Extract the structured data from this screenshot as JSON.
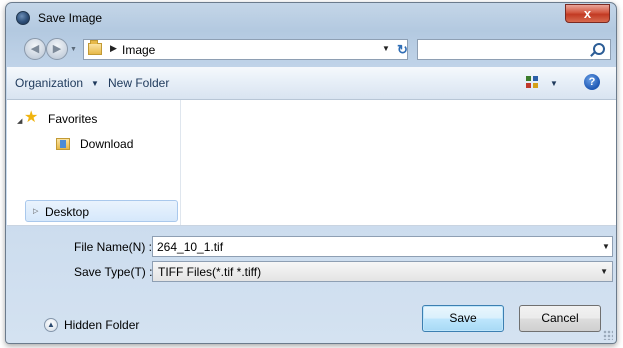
{
  "window": {
    "title": "Save Image",
    "close_label": "x"
  },
  "navbar": {
    "breadcrumb": "Image",
    "search_placeholder": ""
  },
  "toolbar": {
    "organization_label": "Organization",
    "new_folder_label": "New Folder"
  },
  "nav_pane": {
    "favorites_label": "Favorites",
    "download_label": "Download",
    "desktop_label": "Desktop"
  },
  "form": {
    "file_name_label": "File Name(N) :",
    "file_name_value": "264_10_1.tif",
    "save_type_label": "Save Type(T) :",
    "save_type_value": "TIFF Files(*.tif *.tiff)"
  },
  "footer": {
    "hidden_folder_label": "Hidden Folder",
    "save_label": "Save",
    "cancel_label": "Cancel"
  },
  "icons": [
    "app-icon",
    "close-icon",
    "back-arrow-icon",
    "forward-arrow-icon",
    "folder-icon",
    "refresh-icon",
    "search-icon",
    "dropdown-arrow-icon",
    "views-icon",
    "help-icon",
    "favorites-star-icon",
    "download-folder-icon",
    "expand-icon",
    "collapse-icon"
  ],
  "colors": {
    "titlebar": "#b3c9e0",
    "close_button": "#c23a23",
    "toolbar_text": "#1e395b",
    "save_button_border": "#3c7fb1"
  }
}
